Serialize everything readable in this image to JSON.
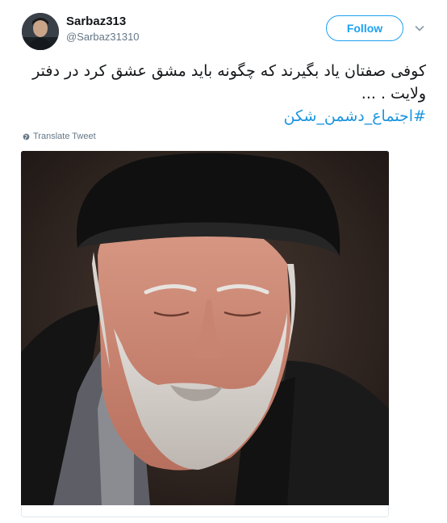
{
  "user": {
    "display_name": "Sarbaz313",
    "handle": "@Sarbaz31310",
    "avatar_icon": "profile-photo"
  },
  "actions": {
    "follow_label": "Follow",
    "more_icon": "chevron-down-icon"
  },
  "tweet": {
    "text": "کوفی صفتان یاد بگیرند که چگونه باید مشق عشق کرد در دفتر ولایت . ...",
    "hashtag": "#اجتماع_دشمن_شکن"
  },
  "translate": {
    "label": "Translate Tweet",
    "icon": "globe-icon"
  },
  "colors": {
    "accent": "#1da1f2",
    "hashtag": "#1b95e0",
    "secondary_text": "#657786"
  }
}
